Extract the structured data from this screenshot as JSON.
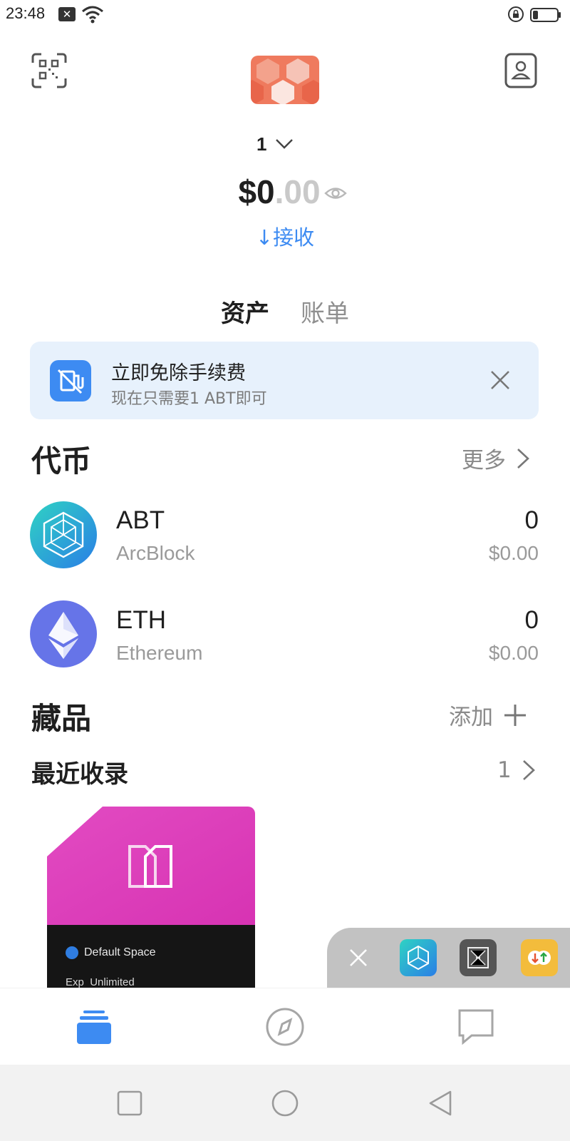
{
  "status_bar": {
    "time": "23:48",
    "icons": [
      "notification-x-icon",
      "wifi-icon",
      "screen-lock-icon",
      "battery-icon"
    ]
  },
  "header": {
    "scan_icon": "qr-scan-icon",
    "contact_icon": "address-book-icon",
    "avatar": "hexagon-avatar"
  },
  "account": {
    "name": "1"
  },
  "balance": {
    "dollars": "$0",
    "cents": ".00",
    "visibility_icon": "eye-icon"
  },
  "receive": {
    "arrow": "↓",
    "label": "接收"
  },
  "tabs": [
    {
      "label": "资产",
      "active": true
    },
    {
      "label": "账单",
      "active": false
    }
  ],
  "banner": {
    "title": "立即免除手续费",
    "subtitle": "现在只需要1 ABT即可",
    "icon": "no-gas-icon"
  },
  "tokens_section": {
    "title": "代币",
    "more_label": "更多",
    "items": [
      {
        "symbol": "ABT",
        "name": "ArcBlock",
        "amount": "0",
        "value": "$0.00",
        "logo": "arcblock-logo"
      },
      {
        "symbol": "ETH",
        "name": "Ethereum",
        "amount": "0",
        "value": "$0.00",
        "logo": "ethereum-logo"
      }
    ]
  },
  "collectibles_section": {
    "title": "藏品",
    "add_label": "添加",
    "recent_title": "最近收录",
    "recent_count": "1"
  },
  "nft_card": {
    "space_label": "Default Space",
    "exp_label": "Exp",
    "exp_value": "Unlimited",
    "colors": {
      "top": "#e03cb9",
      "bottom": "#141414"
    }
  },
  "tray": {
    "apps": [
      "arcblock-app-icon",
      "network-app-icon",
      "transfer-app-icon"
    ]
  },
  "bottom_nav": {
    "items": [
      "wallet-icon",
      "compass-icon",
      "chat-icon"
    ],
    "active_color": "#3d8bf2"
  },
  "system_nav": [
    "recents-square-icon",
    "home-circle-icon",
    "back-triangle-icon"
  ]
}
